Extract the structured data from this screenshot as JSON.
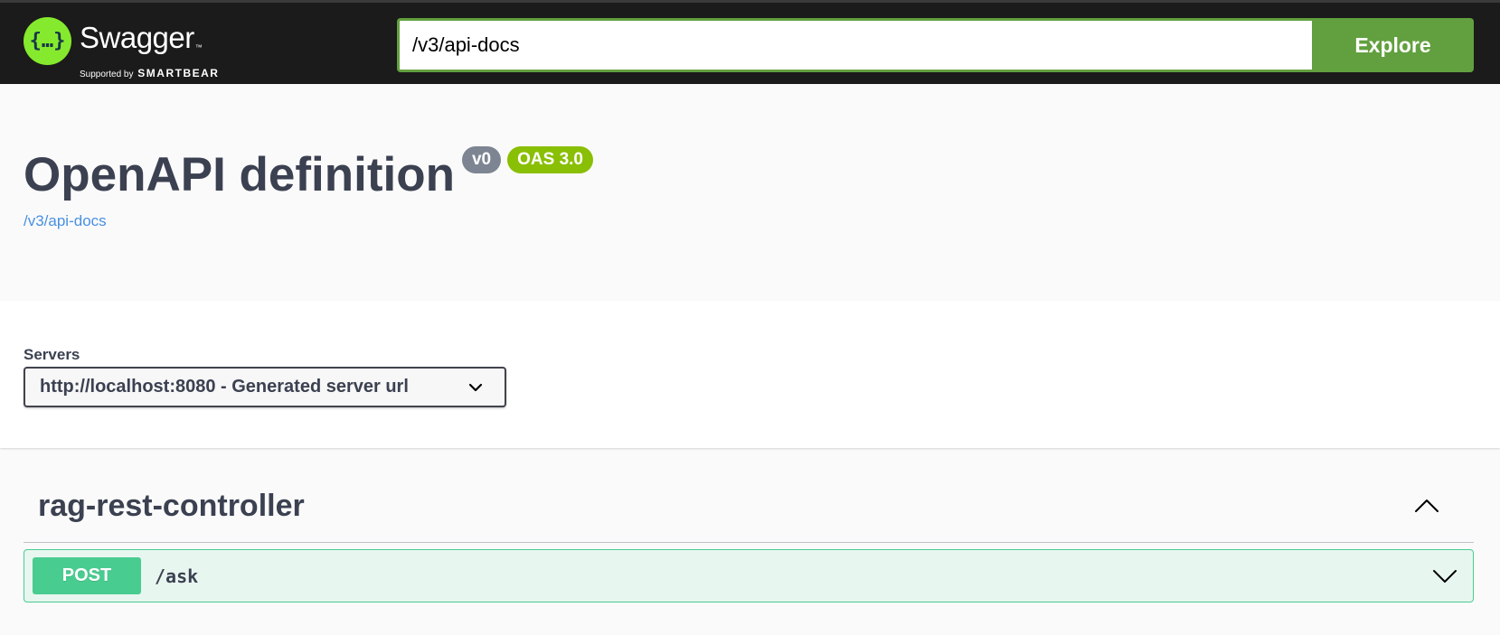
{
  "topbar": {
    "logo_title": "Swagger",
    "logo_trademark": "™",
    "logo_supported_by": "Supported by",
    "logo_brand": "SMARTBEAR",
    "url_value": "/v3/api-docs",
    "explore_label": "Explore"
  },
  "info": {
    "title": "OpenAPI definition",
    "version_badge": "v0",
    "oas_badge": "OAS 3.0",
    "spec_link": "/v3/api-docs"
  },
  "servers": {
    "label": "Servers",
    "selected": "http://localhost:8080 - Generated server url"
  },
  "operations": {
    "tag": "rag-rest-controller",
    "items": [
      {
        "method": "POST",
        "path": "/ask"
      }
    ]
  },
  "colors": {
    "topbar_bg": "#1b1b1b",
    "accent_green": "#62a03f",
    "logo_green": "#85ea2d",
    "post_green": "#49cc90",
    "post_bg": "#e8f6f0",
    "version_badge": "#7d8492",
    "oas_badge": "#89bf04",
    "link_blue": "#4990e2",
    "text_dark": "#3b4151"
  },
  "icons": {
    "logo": "swagger-logo-icon",
    "servers_dropdown": "chevron-down-icon",
    "tag_toggle": "chevron-up-icon",
    "op_toggle": "chevron-down-icon"
  }
}
